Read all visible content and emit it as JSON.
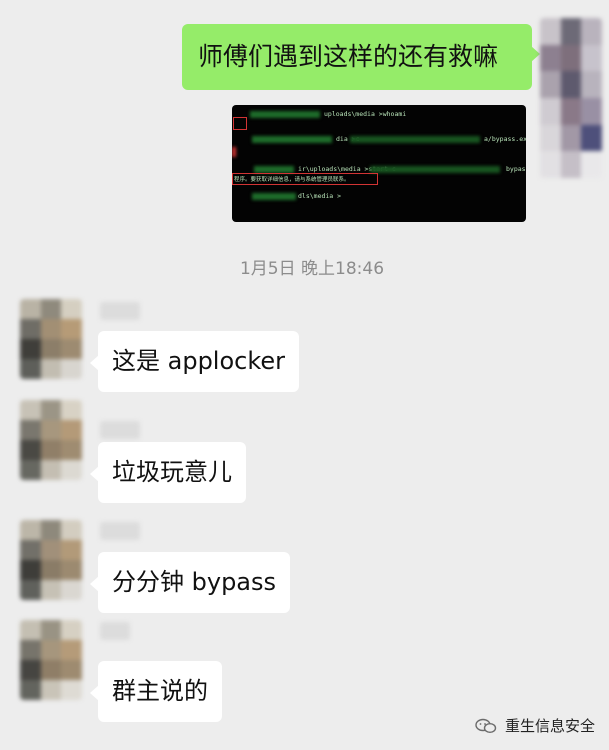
{
  "messages": {
    "outgoing_1": "师傅们遇到这样的还有救嘛",
    "incoming_1": "这是 applocker",
    "incoming_2": "垃圾玩意儿",
    "incoming_3": "分分钟 bypass",
    "incoming_4": "群主说的"
  },
  "timestamp": "1月5日 晚上18:46",
  "terminal": {
    "line_1": "uploads\\media >whoami",
    "line_2": "dia >c",
    "line_2_right": "a/bypass.exe",
    "line_3": "ir\\uploads\\media >start c",
    "line_3_right": "bypas",
    "line_4": "程序。要获取详细信息，请与系统管理员联系。",
    "line_5": "dls\\media >"
  },
  "watermark": "重生信息安全",
  "colors": {
    "background": "#ededed",
    "outgoing_bubble": "#95ec69",
    "incoming_bubble": "#ffffff",
    "terminal_bg": "#030303",
    "highlight_box": "#d23434"
  }
}
